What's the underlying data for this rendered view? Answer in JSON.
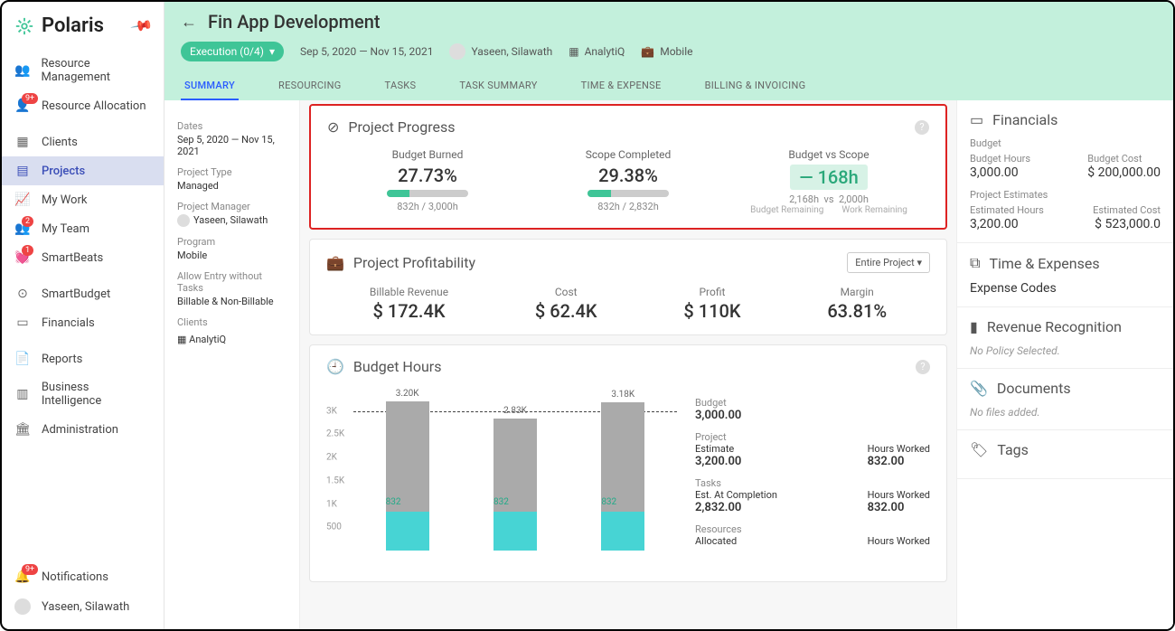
{
  "app": {
    "name": "Polaris"
  },
  "sidebar": {
    "items": [
      {
        "label": "Resource Management",
        "icon": "👥"
      },
      {
        "label": "Resource Allocation",
        "icon": "👤",
        "badge": "9+"
      },
      {
        "label": "Clients",
        "icon": "▦"
      },
      {
        "label": "Projects",
        "icon": "▤",
        "active": true
      },
      {
        "label": "My Work",
        "icon": "📈"
      },
      {
        "label": "My Team",
        "icon": "👥",
        "badge": "2"
      },
      {
        "label": "SmartBeats",
        "icon": "💓",
        "badge": "1"
      },
      {
        "label": "SmartBudget",
        "icon": "⊙"
      },
      {
        "label": "Financials",
        "icon": "▭"
      },
      {
        "label": "Reports",
        "icon": "📄"
      },
      {
        "label": "Business Intelligence",
        "icon": "▥"
      },
      {
        "label": "Administration",
        "icon": "🏛"
      }
    ],
    "notifications": {
      "label": "Notifications",
      "badge": "9+"
    },
    "user": {
      "name": "Yaseen, Silawath"
    }
  },
  "header": {
    "title": "Fin App Development",
    "status_pill": "Execution (0/4)",
    "date_range": "Sep 5, 2020 — Nov 15, 2021",
    "manager": "Yaseen, Silawath",
    "client": "AnalytiQ",
    "program": "Mobile",
    "tabs": [
      "SUMMARY",
      "RESOURCING",
      "TASKS",
      "TASK SUMMARY",
      "TIME & EXPENSE",
      "BILLING & INVOICING"
    ],
    "active_tab": 0
  },
  "details": {
    "dates_lbl": "Dates",
    "dates": "Sep 5, 2020 — Nov 15, 2021",
    "type_lbl": "Project Type",
    "type": "Managed",
    "pm_lbl": "Project Manager",
    "pm": "Yaseen, Silawath",
    "program_lbl": "Program",
    "program": "Mobile",
    "allow_lbl": "Allow Entry without Tasks",
    "allow": "Billable & Non-Billable",
    "clients_lbl": "Clients",
    "client": "AnalytiQ"
  },
  "progress": {
    "title": "Project Progress",
    "budget_burned": {
      "label": "Budget Burned",
      "pct": "27.73%",
      "fill": 27.73,
      "sub": "832h / 3,000h"
    },
    "scope": {
      "label": "Scope Completed",
      "pct": "29.38%",
      "fill": 29.38,
      "sub": "832h / 2,832h"
    },
    "bvs": {
      "label": "Budget vs Scope",
      "delta": "— 168h",
      "rem_budget": "2,168h",
      "rem_work": "2,000h",
      "lb": "Budget Remaining",
      "lw": "Work Remaining"
    }
  },
  "profit": {
    "title": "Project Profitability",
    "selector": "Entire Project",
    "rev_lbl": "Billable Revenue",
    "rev": "$ 172.4K",
    "cost_lbl": "Cost",
    "cost": "$ 62.4K",
    "profit_lbl": "Profit",
    "profit_v": "$ 110K",
    "margin_lbl": "Margin",
    "margin": "63.81%"
  },
  "budget": {
    "title": "Budget Hours",
    "side": {
      "budget_lbl": "Budget",
      "budget": "3,000.00",
      "project_lbl": "Project",
      "est_lbl": "Estimate",
      "est": "3,200.00",
      "hw_lbl": "Hours Worked",
      "hw": "832.00",
      "tasks_lbl": "Tasks",
      "eac_lbl": "Est. At Completion",
      "eac": "2,832.00",
      "thw": "832.00",
      "res_lbl": "Resources",
      "alloc_lbl": "Allocated",
      "rhw_lbl": "Hours Worked"
    }
  },
  "chart_data": {
    "type": "bar",
    "ylim": [
      0,
      3500
    ],
    "yticks": [
      "3K",
      "2.5K",
      "2K",
      "1.5K",
      "1K",
      "500"
    ],
    "budget_line": 3000,
    "series": [
      {
        "name": "Estimate",
        "values": [
          3200,
          2830,
          3180
        ],
        "labels": [
          "3.20K",
          "2.83K",
          "3.18K"
        ]
      },
      {
        "name": "Worked",
        "values": [
          832,
          832,
          832
        ],
        "labels": [
          "832",
          "832",
          "832"
        ]
      }
    ]
  },
  "right": {
    "financials": {
      "title": "Financials",
      "budget_lbl": "Budget",
      "bh_lbl": "Budget Hours",
      "bh": "3,000.00",
      "bc_lbl": "Budget Cost",
      "bc": "$ 200,000.00",
      "pe_lbl": "Project Estimates",
      "eh_lbl": "Estimated Hours",
      "eh": "3,200.00",
      "ec_lbl": "Estimated Cost",
      "ec": "$ 523,000.0"
    },
    "time": {
      "title": "Time & Expenses",
      "exp": "Expense Codes"
    },
    "rev": {
      "title": "Revenue Recognition",
      "none": "No Policy Selected."
    },
    "docs": {
      "title": "Documents",
      "none": "No files added."
    },
    "tags": {
      "title": "Tags"
    }
  }
}
